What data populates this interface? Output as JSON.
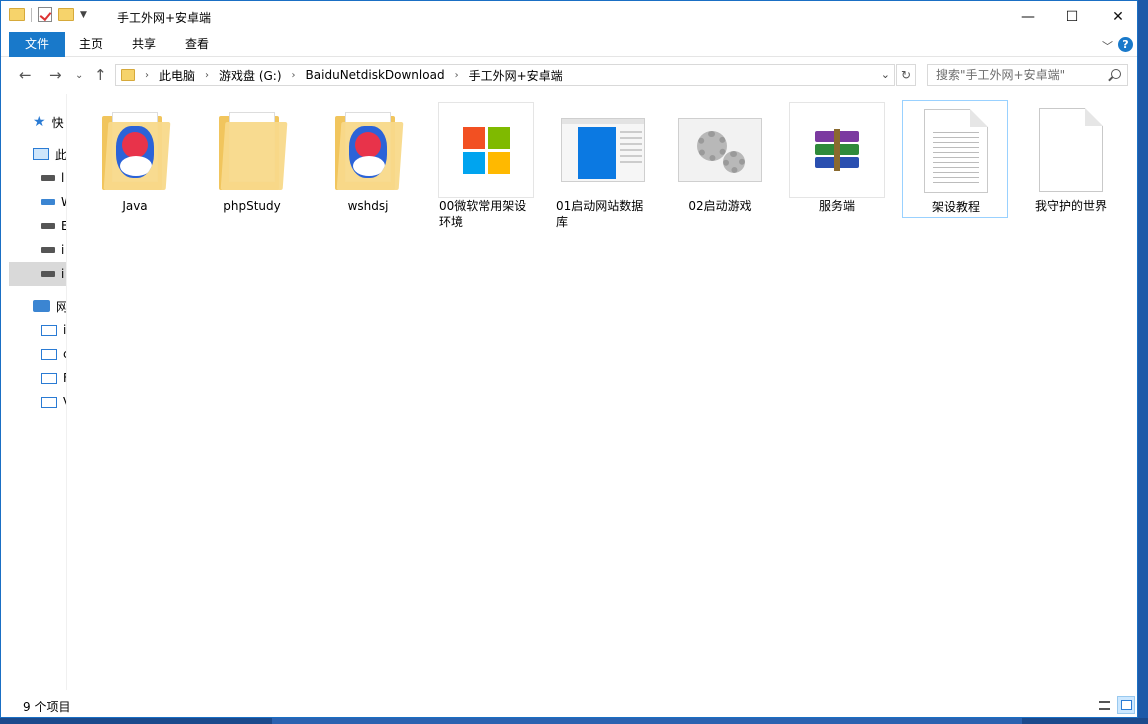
{
  "window": {
    "title": "手工外网+安卓端",
    "controls": {
      "minimize": "—",
      "maximize": "☐",
      "close": "✕"
    }
  },
  "ribbon": {
    "tabs": [
      "文件",
      "主页",
      "共享",
      "查看"
    ]
  },
  "address": {
    "crumbs": [
      "此电脑",
      "游戏盘 (G:)",
      "BaiduNetdiskDownload",
      "手工外网+安卓端"
    ],
    "search_placeholder": "搜索\"手工外网+安卓端\""
  },
  "navpane": {
    "items": [
      {
        "label": "快",
        "icon": "star-icon"
      },
      {
        "label": "此",
        "icon": "computer-icon"
      },
      {
        "label": "l",
        "icon": "drive-icon"
      },
      {
        "label": "W",
        "icon": "windows-drive-icon"
      },
      {
        "label": "E",
        "icon": "drive-icon"
      },
      {
        "label": "i",
        "icon": "drive-icon"
      },
      {
        "label": "i",
        "icon": "drive-icon",
        "selected": true
      },
      {
        "label": "网",
        "icon": "network-icon"
      },
      {
        "label": "i",
        "icon": "monitor-icon"
      },
      {
        "label": "c",
        "icon": "monitor-icon"
      },
      {
        "label": "F",
        "icon": "monitor-icon"
      },
      {
        "label": "V",
        "icon": "monitor-icon"
      }
    ]
  },
  "files": [
    {
      "name": "Java",
      "icon": "app-folder-icon"
    },
    {
      "name": "phpStudy",
      "icon": "folder-icon"
    },
    {
      "name": "wshdsj",
      "icon": "app-folder-icon"
    },
    {
      "name": "00微软常用架设环境",
      "icon": "windows-logo-icon"
    },
    {
      "name": "01启动网站数据库",
      "icon": "window-screenshot-icon"
    },
    {
      "name": "02启动游戏",
      "icon": "gears-icon"
    },
    {
      "name": "服务端",
      "icon": "winrar-icon"
    },
    {
      "name": "架设教程",
      "icon": "text-document-icon",
      "selected": true
    },
    {
      "name": "我守护的世界",
      "icon": "blank-document-icon"
    }
  ],
  "colors": {
    "accent": "#1979ca",
    "ms_red": "#f25022",
    "ms_green": "#7fba00",
    "ms_blue": "#00a4ef",
    "ms_yellow": "#ffb900"
  },
  "status": {
    "item_count": "9 个项目"
  }
}
